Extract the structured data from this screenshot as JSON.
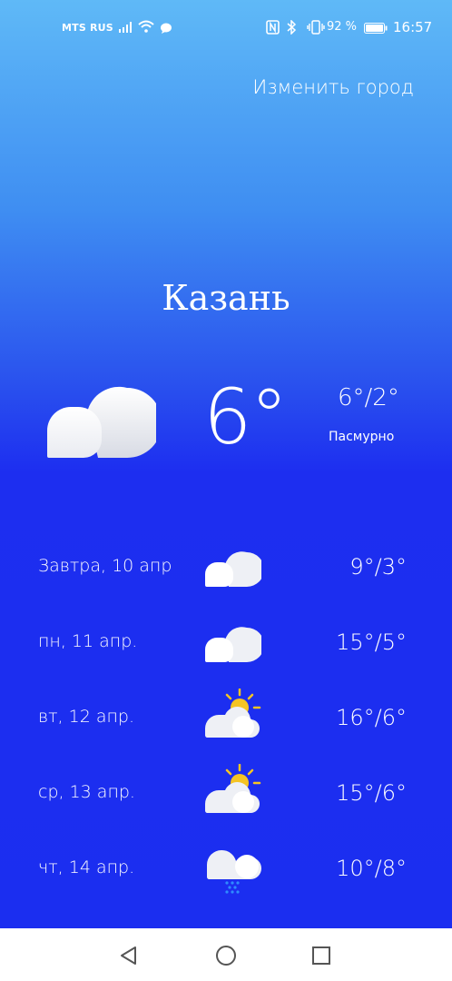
{
  "status_bar": {
    "carrier": "MTS RUS",
    "battery_percent": "92 %",
    "time": "16:57",
    "icons": [
      "signal-icon",
      "wifi-icon",
      "message-icon",
      "nfc-icon",
      "bluetooth-icon",
      "vibrate-icon",
      "battery-icon"
    ]
  },
  "header": {
    "change_city": "Изменить город"
  },
  "current": {
    "city": "Казань",
    "temp": "6°",
    "range": "6°/2°",
    "description": "Пасмурно",
    "icon": "cloud-icon"
  },
  "forecast": [
    {
      "day": "Завтра, 10 апр",
      "temp": "9°/3°",
      "icon": "cloud-icon"
    },
    {
      "day": "пн, 11 апр.",
      "temp": "15°/5°",
      "icon": "cloud-icon"
    },
    {
      "day": "вт, 12 апр.",
      "temp": "16°/6°",
      "icon": "sun-cloud-icon"
    },
    {
      "day": "ср, 13 апр.",
      "temp": "15°/6°",
      "icon": "sun-cloud-icon"
    },
    {
      "day": "чт, 14 апр.",
      "temp": "10°/8°",
      "icon": "rain-cloud-icon"
    }
  ],
  "nav": [
    "back-icon",
    "home-icon",
    "recents-icon"
  ],
  "colors": {
    "sky_top": "#5fb9f7",
    "sky_bottom": "#1b2ef0",
    "sun": "#f5c423",
    "rain": "#2f8cff"
  }
}
